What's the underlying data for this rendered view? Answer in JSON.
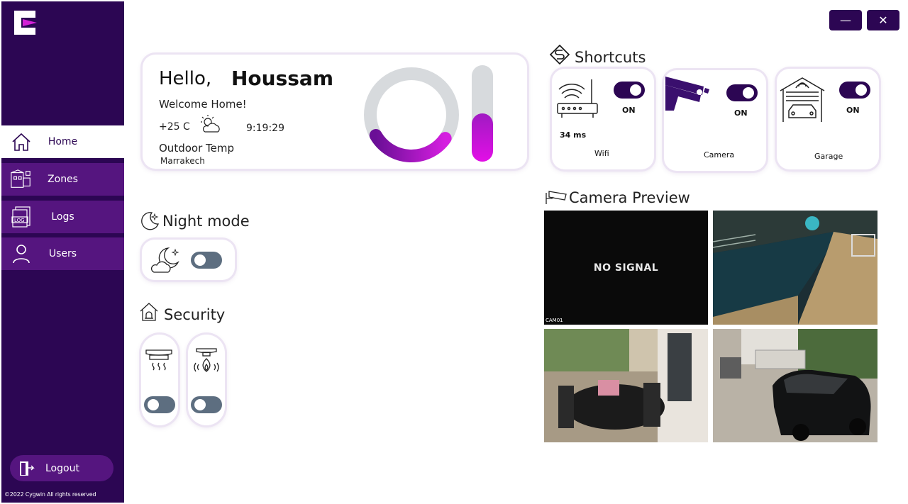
{
  "sidebar": {
    "items": [
      {
        "label": "Home",
        "icon": "home-icon",
        "active": true
      },
      {
        "label": "Zones",
        "icon": "zones-icon",
        "active": false
      },
      {
        "label": "Logs",
        "icon": "logs-icon",
        "active": false
      },
      {
        "label": "Users",
        "icon": "user-icon",
        "active": false
      }
    ],
    "logout_label": "Logout",
    "copyright": "©2022 Cygwin All rights reserved"
  },
  "window": {
    "minimize": "—",
    "close": "✕"
  },
  "greeting": {
    "hello": "Hello,",
    "name": "Houssam",
    "welcome": "Welcome Home!",
    "temperature": "+25 C",
    "time": "9:19:29",
    "outdoor_label": "Outdoor Temp",
    "city": "Marrakech",
    "gauge_ring_level": 0.32,
    "gauge_bar_level": 0.5
  },
  "night_mode": {
    "title": "Night mode",
    "enabled": false
  },
  "security": {
    "title": "Security",
    "smoke_detector_enabled": false,
    "fire_detector_enabled": false
  },
  "shortcuts": {
    "title": "Shortcuts",
    "items": [
      {
        "label": "Wifi",
        "state": "ON",
        "extra": "34 ms"
      },
      {
        "label": "Camera",
        "state": "ON"
      },
      {
        "label": "Garage",
        "state": "ON"
      }
    ]
  },
  "camera_preview": {
    "title": "Camera Preview",
    "feeds": [
      {
        "status": "NO SIGNAL",
        "overlay": "CAM01"
      },
      {
        "status": ""
      },
      {
        "status": ""
      },
      {
        "status": ""
      }
    ]
  },
  "colors": {
    "sidebar": "#2c0653",
    "nav_item": "#55157f",
    "accent": "#c219d4",
    "toggle_off": "#5d6e80"
  }
}
